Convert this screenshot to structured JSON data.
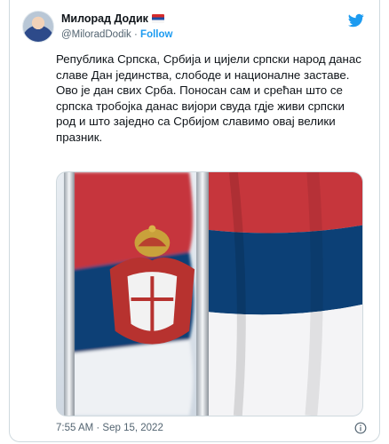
{
  "author": {
    "display_name": "Милорад Додик",
    "handle": "@MiloradDodik",
    "separator": "·",
    "follow_label": "Follow"
  },
  "tweet": {
    "paragraph_1": "Република Српска, Србија и цијели српски народ данас славе Дан јединства, слободе и националне заставе.",
    "paragraph_2": "Ово је дан свих Срба. Поносан сам и срећан што се српска тробојка данас вијори свуда гдје живи српски род и што заједно са Србијом славимо овај велики празник.",
    "timestamp": "7:55 AM · Sep 15, 2022"
  },
  "icons": {
    "platform": "twitter-bird-icon",
    "info": "info-icon",
    "author_flag": "serbian-flag-emoji"
  },
  "colors": {
    "accent": "#1d9bf0",
    "flag_red": "#c6363c",
    "flag_blue": "#0c4076",
    "flag_white": "#ffffff",
    "text": "#0f1419",
    "secondary": "#536471",
    "border": "#cfd9de"
  }
}
